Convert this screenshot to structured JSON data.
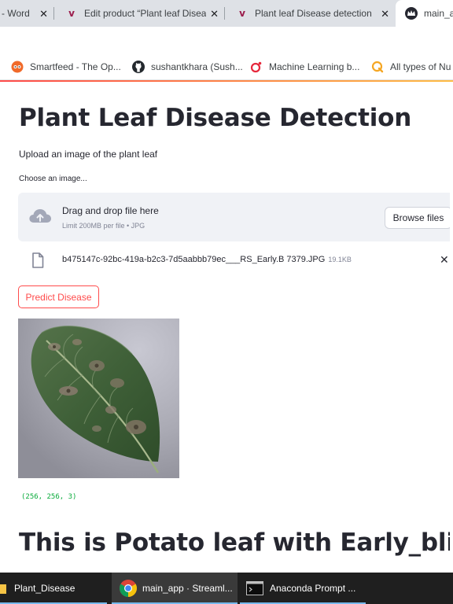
{
  "browser": {
    "tabs": [
      {
        "label": "- Word",
        "close": "✕",
        "icon": "wordpress-icon"
      },
      {
        "label": "Edit product “Plant leaf Disea",
        "close": "✕",
        "icon": "v-logo-icon"
      },
      {
        "label": "Plant leaf Disease detection",
        "close": "✕",
        "icon": "v-logo-icon"
      },
      {
        "label": "main_a",
        "close": "",
        "icon": "streamlit-crown-icon"
      }
    ],
    "bookmarks": [
      {
        "label": "Smartfeed - The Op...",
        "icon": "smartfeed-icon"
      },
      {
        "label": "sushantkhara (Sush...",
        "icon": "github-icon"
      },
      {
        "label": "Machine Learning b...",
        "icon": "ml-blog-icon"
      },
      {
        "label": "All types of Nu",
        "icon": "bookmark-q-icon"
      }
    ]
  },
  "app": {
    "title": "Plant Leaf Disease Detection",
    "subtitle": "Upload an image of the plant leaf",
    "uploader": {
      "label": "Choose an image...",
      "drop_text": "Drag and drop file here",
      "limit_text": "Limit 200MB per file • JPG",
      "browse_label": "Browse files"
    },
    "file": {
      "name": "b475147c-92bc-419a-b2c3-7d5aabbb79ec___RS_Early.B 7379.JPG",
      "size": "19.1KB",
      "remove": "✕"
    },
    "predict_label": "Predict Disease",
    "image_shape": "(256, 256, 3)",
    "result": "This is Potato leaf with Early_blight"
  },
  "taskbar": {
    "items": [
      {
        "label": "Plant_Disease",
        "icon": "folder-icon"
      },
      {
        "label": "main_app · Streaml...",
        "icon": "chrome-icon"
      },
      {
        "label": "Anaconda Prompt ...",
        "icon": "terminal-icon"
      }
    ]
  },
  "colors": {
    "primary": "#ff4b4b",
    "text": "#262730",
    "dropzone_bg": "#f0f2f6",
    "shape_text": "#09ab3b",
    "taskbar_bg": "#1f1f1f"
  }
}
